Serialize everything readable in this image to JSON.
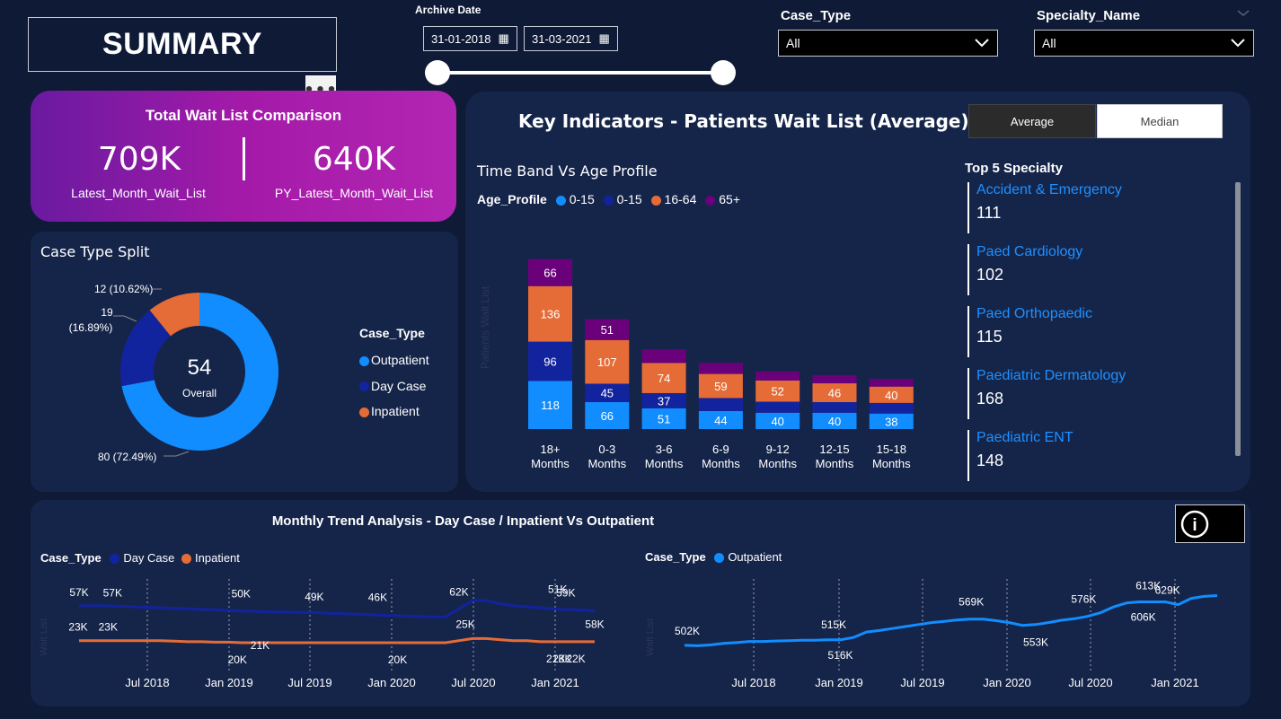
{
  "header": {
    "title": "SUMMARY",
    "more_options": "•••",
    "archive_label": "Archive Date",
    "date_start": "31-01-2018",
    "date_end": "31-03-2021",
    "date_slider": {
      "start_fraction": 0.0,
      "end_fraction": 1.0
    },
    "case_type_label": "Case_Type",
    "case_type_value": "All",
    "specialty_label": "Specialty_Name",
    "specialty_value": "All"
  },
  "wait_card": {
    "title": "Total Wait List Comparison",
    "latest_value": "709K",
    "latest_label": "Latest_Month_Wait_List",
    "py_value": "640K",
    "py_label": "PY_Latest_Month_Wait_List"
  },
  "kpi": {
    "title": "Key Indicators - Patients Wait List (Average)",
    "tab_average": "Average",
    "tab_median": "Median",
    "active_tab": "Average",
    "band_title": "Time Band Vs Age Profile",
    "legend_title": "Age_Profile",
    "legend": [
      "0-15",
      "0-15",
      "16-64",
      "65+"
    ],
    "y_axis_label": "Patients Wait List"
  },
  "specialty": {
    "title": "Top 5 Specialty",
    "items": [
      {
        "name": "Accident & Emergency",
        "value": "111"
      },
      {
        "name": "Paed Cardiology",
        "value": "102"
      },
      {
        "name": "Paed Orthopaedic",
        "value": "115"
      },
      {
        "name": "Paediatric Dermatology",
        "value": "168"
      },
      {
        "name": "Paediatric ENT",
        "value": "148"
      }
    ]
  },
  "case_split": {
    "title": "Case Type Split",
    "center_value": "54",
    "center_label": "Overall",
    "legend_title": "Case_Type",
    "legend": [
      "Outpatient",
      "Day Case",
      "Inpatient"
    ],
    "label_inpatient": "12 (10.62%)",
    "label_daycase_1": "19",
    "label_daycase_2": "(16.89%)",
    "label_outpatient": "80 (72.49%)"
  },
  "trend": {
    "title": "Monthly Trend Analysis - Day Case / Inpatient Vs Outpatient",
    "left_legend_title": "Case_Type",
    "left_legend": [
      "Day Case",
      "Inpatient"
    ],
    "right_legend_title": "Case_Type",
    "right_legend": [
      "Outpatient"
    ],
    "info_icon": "i",
    "left_y_label": "Wait List",
    "right_y_label": "Wait List"
  },
  "colors": {
    "outpatient": "#118dff",
    "day_case": "#12239e",
    "inpatient": "#e66c37",
    "age_65": "#6b007b",
    "accent_blue": "#1e90ff"
  },
  "chart_data": [
    {
      "type": "bar",
      "title": "Time Band Vs Age Profile",
      "stacked": true,
      "categories": [
        "18+ Months",
        "0-3 Months",
        "3-6 Months",
        "6-9 Months",
        "9-12 Months",
        "12-15 Months",
        "15-18 Months"
      ],
      "series": [
        {
          "name": "0-15",
          "color": "#118dff",
          "values": [
            118,
            66,
            51,
            44,
            40,
            40,
            38
          ]
        },
        {
          "name": "0-15",
          "color": "#12239e",
          "values": [
            96,
            45,
            37,
            32,
            27,
            26,
            26
          ]
        },
        {
          "name": "16-64",
          "color": "#e66c37",
          "values": [
            136,
            107,
            74,
            59,
            52,
            46,
            40
          ]
        },
        {
          "name": "65+",
          "color": "#6b007b",
          "values": [
            66,
            51,
            33,
            27,
            22,
            20,
            19
          ]
        }
      ],
      "labeled_values": [
        [
          118,
          66,
          51,
          44,
          40,
          40,
          38
        ],
        [
          96,
          45,
          37,
          null,
          null,
          null,
          null
        ],
        [
          136,
          107,
          74,
          59,
          52,
          46,
          40
        ],
        [
          66,
          51,
          null,
          null,
          null,
          null,
          null
        ]
      ],
      "ylabel": "Patients Wait List",
      "ylim": [
        0,
        420
      ],
      "legend_position": "top-left"
    },
    {
      "type": "pie",
      "title": "Case Type Split",
      "donut": true,
      "labels": [
        "Outpatient",
        "Day Case",
        "Inpatient"
      ],
      "values": [
        80,
        19,
        12
      ],
      "percent": [
        72.49,
        16.89,
        10.62
      ],
      "colors": [
        "#118dff",
        "#12239e",
        "#e66c37"
      ],
      "center_total": 54
    },
    {
      "type": "line",
      "title": "Monthly Trend Analysis - Day Case / Inpatient Vs Outpatient",
      "x_ticks": [
        "Jul 2018",
        "Jan 2019",
        "Jul 2019",
        "Jan 2020",
        "Jul 2020",
        "Jan 2021"
      ],
      "x_months": [
        "2018-01",
        "2018-02",
        "2018-03",
        "2018-04",
        "2018-05",
        "2018-06",
        "2018-07",
        "2018-08",
        "2018-09",
        "2018-10",
        "2018-11",
        "2018-12",
        "2019-01",
        "2019-02",
        "2019-03",
        "2019-04",
        "2019-05",
        "2019-06",
        "2019-07",
        "2019-08",
        "2019-09",
        "2019-10",
        "2019-11",
        "2019-12",
        "2020-01",
        "2020-02",
        "2020-03",
        "2020-04",
        "2020-05",
        "2020-06",
        "2020-07",
        "2020-08",
        "2020-09",
        "2020-10",
        "2020-11",
        "2020-12",
        "2021-01",
        "2021-02",
        "2021-03"
      ],
      "series": [
        {
          "name": "Day Case",
          "color": "#12239e",
          "values": [
            57,
            57,
            57,
            56.5,
            56,
            55.5,
            55,
            54.5,
            54,
            53.5,
            53,
            52.5,
            52,
            51.5,
            51,
            51,
            50.5,
            50.5,
            50,
            49.5,
            49,
            48.5,
            48,
            47.5,
            47,
            46.5,
            46,
            46,
            54,
            62,
            62,
            59,
            57,
            56,
            55,
            54,
            53,
            53,
            52
          ]
        },
        {
          "name": "Inpatient",
          "color": "#e66c37",
          "values": [
            23,
            23,
            23,
            23,
            23,
            23,
            23,
            22.5,
            22,
            22,
            21.5,
            21.5,
            21,
            21,
            21,
            21,
            21,
            21,
            21,
            21,
            21,
            21,
            21,
            21,
            21,
            21,
            21,
            21,
            23,
            25,
            25,
            24,
            23,
            23,
            22,
            22,
            22,
            22,
            22
          ]
        }
      ],
      "point_labels": [
        {
          "series": "Day Case",
          "month": "2018-01",
          "label": "57K"
        },
        {
          "series": "Day Case",
          "month": "2018-04",
          "label": "57K"
        },
        {
          "series": "Day Case",
          "month": "2019-01",
          "label": "50K"
        },
        {
          "series": "Day Case",
          "month": "2019-07",
          "label": "49K"
        },
        {
          "series": "Day Case",
          "month": "2019-12",
          "label": "46K"
        },
        {
          "series": "Day Case",
          "month": "2020-05",
          "label": "62K"
        },
        {
          "series": "Day Case",
          "month": "2020-12",
          "label": "51K"
        },
        {
          "series": "Day Case",
          "month": "2021-01",
          "label": "59K"
        },
        {
          "series": "Day Case",
          "month": "2021-03",
          "label": "58K"
        },
        {
          "series": "Inpatient",
          "month": "2018-01",
          "label": "23K"
        },
        {
          "series": "Inpatient",
          "month": "2018-04",
          "label": "23K"
        },
        {
          "series": "Inpatient",
          "month": "2019-01",
          "label": "20K"
        },
        {
          "series": "Inpatient",
          "month": "2019-03",
          "label": "21K"
        },
        {
          "series": "Inpatient",
          "month": "2020-01",
          "label": "20K"
        },
        {
          "series": "Inpatient",
          "month": "2020-06",
          "label": "25K"
        },
        {
          "series": "Inpatient",
          "month": "2020-12",
          "label": "21K"
        },
        {
          "series": "Inpatient",
          "month": "2021-01",
          "label": "23K"
        },
        {
          "series": "Inpatient",
          "month": "2021-03",
          "label": "22K"
        }
      ],
      "ylabel": "Wait List",
      "ylim": [
        0,
        70
      ]
    },
    {
      "type": "line",
      "title": "Monthly Trend Analysis - Outpatient",
      "x_ticks": [
        "Jul 2018",
        "Jan 2019",
        "Jul 2019",
        "Jan 2020",
        "Jul 2020",
        "Jan 2021"
      ],
      "x_months": [
        "2018-01",
        "2018-02",
        "2018-03",
        "2018-04",
        "2018-05",
        "2018-06",
        "2018-07",
        "2018-08",
        "2018-09",
        "2018-10",
        "2018-11",
        "2018-12",
        "2019-01",
        "2019-02",
        "2019-03",
        "2019-04",
        "2019-05",
        "2019-06",
        "2019-07",
        "2019-08",
        "2019-09",
        "2019-10",
        "2019-11",
        "2019-12",
        "2020-01",
        "2020-02",
        "2020-03",
        "2020-04",
        "2020-05",
        "2020-06",
        "2020-07",
        "2020-08",
        "2020-09",
        "2020-10",
        "2020-11",
        "2020-12",
        "2021-01",
        "2021-02",
        "2021-03"
      ],
      "series": [
        {
          "name": "Outpatient",
          "color": "#118dff",
          "values": [
            502,
            501,
            503,
            507,
            509,
            512,
            512,
            513,
            514,
            515,
            515,
            516,
            516,
            522,
            536,
            540,
            545,
            550,
            555,
            560,
            563,
            567,
            569,
            569,
            565,
            560,
            553,
            555,
            560,
            566,
            570,
            576,
            585,
            600,
            610,
            613,
            613,
            613,
            606,
            622,
            627,
            629
          ]
        }
      ],
      "point_labels": [
        {
          "series": "Outpatient",
          "month": "2018-01",
          "label": "502K"
        },
        {
          "series": "Outpatient",
          "month": "2018-12",
          "label": "515K"
        },
        {
          "series": "Outpatient",
          "month": "2019-01",
          "label": "516K"
        },
        {
          "series": "Outpatient",
          "month": "2019-11",
          "label": "569K"
        },
        {
          "series": "Outpatient",
          "month": "2020-03",
          "label": "553K"
        },
        {
          "series": "Outpatient",
          "month": "2020-08",
          "label": "576K"
        },
        {
          "series": "Outpatient",
          "month": "2020-12",
          "label": "613K"
        },
        {
          "series": "Outpatient",
          "month": "2021-01",
          "label": "606K"
        },
        {
          "series": "Outpatient",
          "month": "2021-03",
          "label": "629K"
        }
      ],
      "ylabel": "Wait List",
      "ylim": [
        440,
        660
      ]
    }
  ]
}
